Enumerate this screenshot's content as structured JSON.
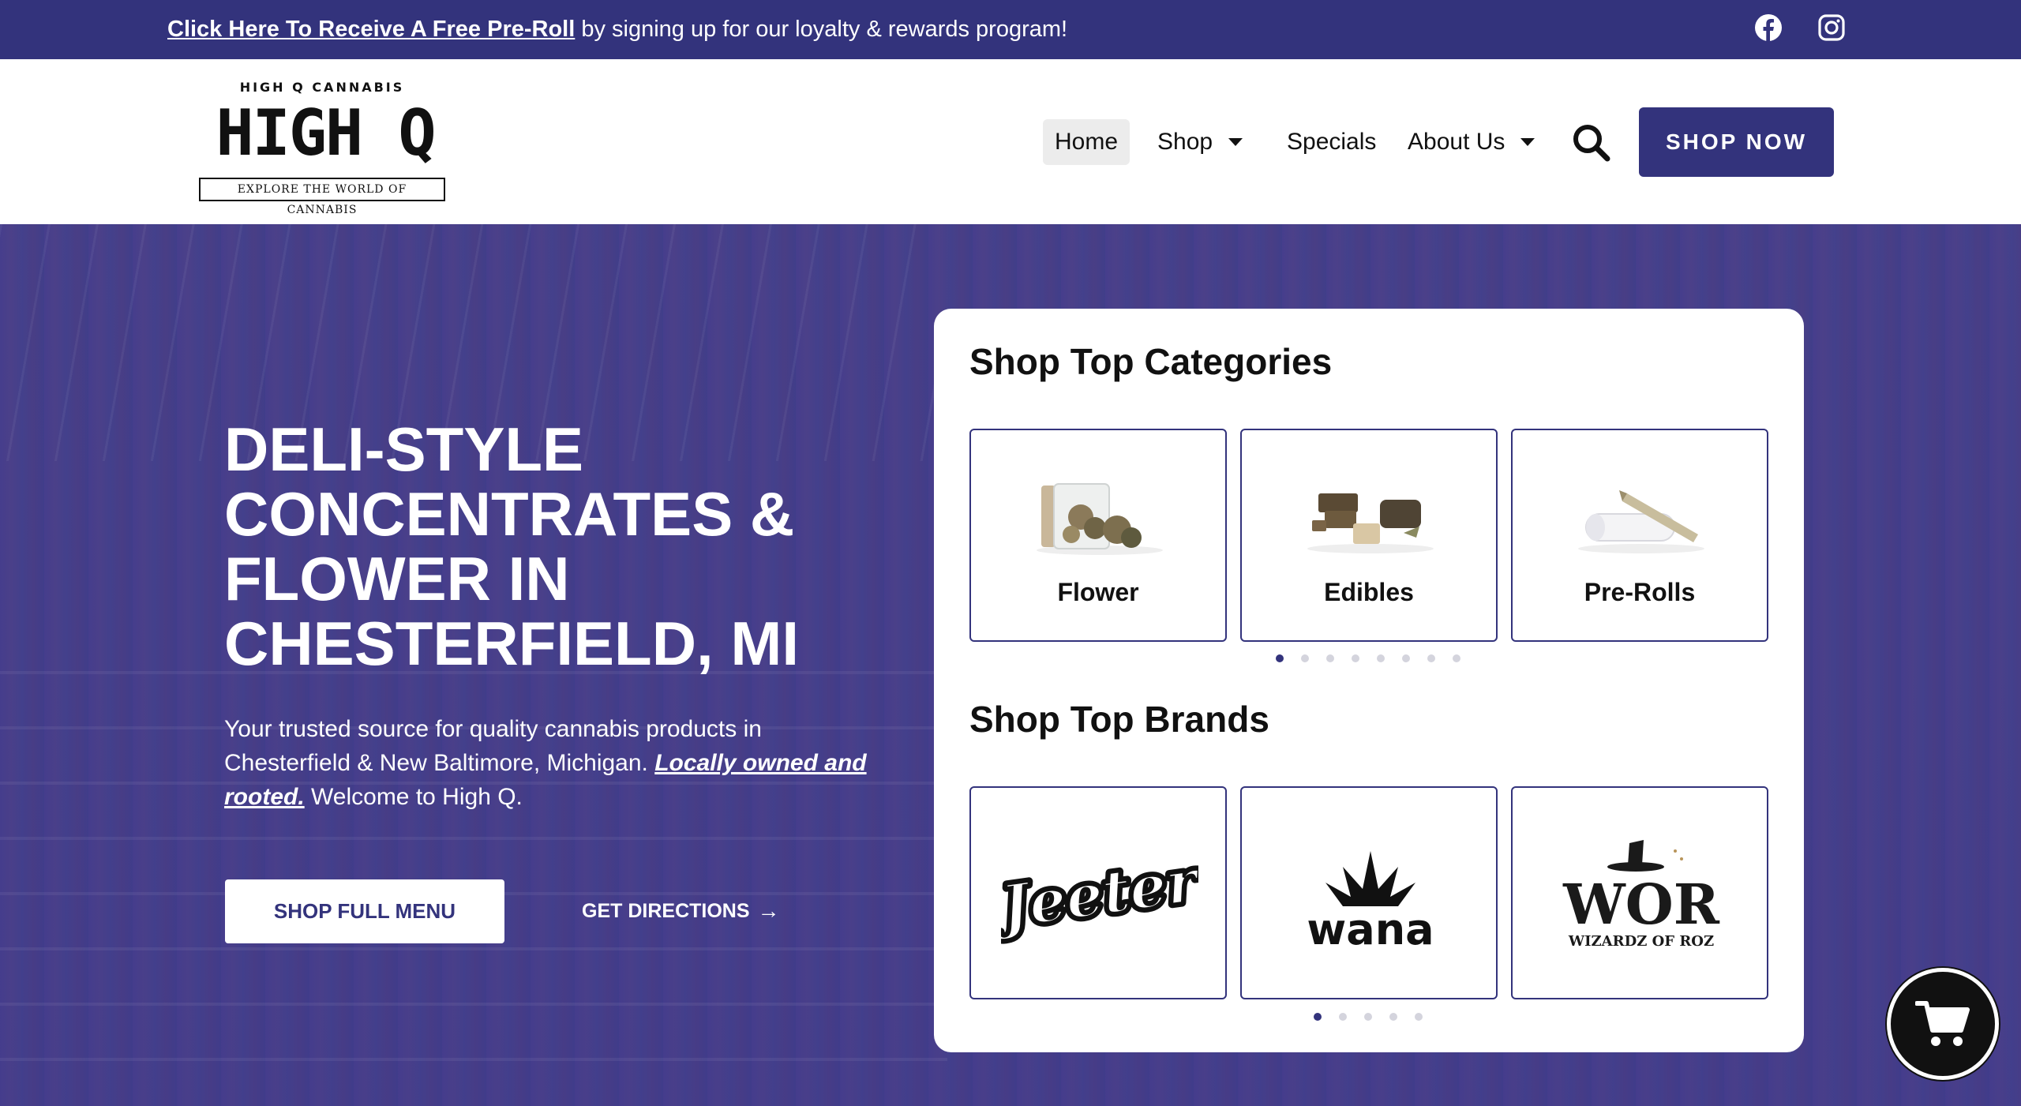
{
  "promo": {
    "link_text": "Click Here To Receive A Free Pre-Roll",
    "rest_text": " by signing up for our loyalty & rewards program!"
  },
  "social": {
    "facebook_icon": "facebook-icon",
    "instagram_icon": "instagram-icon"
  },
  "logo": {
    "top_text": "HIGH Q CANNABIS",
    "main_text": "HIGH Q",
    "tagline": "EXPLORE THE WORLD OF CANNABIS"
  },
  "nav": {
    "home": "Home",
    "shop": "Shop",
    "specials": "Specials",
    "about": "About Us",
    "search_icon": "search-icon",
    "shop_now": "SHOP NOW"
  },
  "hero": {
    "title": "DELI-STYLE CONCENTRATES & FLOWER IN CHESTERFIELD, MI",
    "desc_part1": "Your trusted source for quality cannabis products in Chesterfield & New Baltimore, Michigan. ",
    "desc_emphasis": "Locally owned and rooted.",
    "desc_part2": " Welcome to High Q.",
    "menu_button": "SHOP FULL MENU",
    "directions_button": "GET DIRECTIONS"
  },
  "categories": {
    "heading": "Shop Top Categories",
    "items": [
      {
        "label": "Flower"
      },
      {
        "label": "Edibles"
      },
      {
        "label": "Pre-Rolls"
      }
    ],
    "dot_count": 8,
    "active_dot": 1
  },
  "brands": {
    "heading": "Shop Top Brands",
    "items": [
      {
        "name": "Jeeter"
      },
      {
        "name": "wana"
      },
      {
        "name": "WOR",
        "subtitle": "WIZARDZ OF ROZ"
      }
    ],
    "dot_count": 5,
    "active_dot": 1
  },
  "cart": {
    "icon": "shopping-cart-icon"
  },
  "colors": {
    "brand": "#33337c",
    "hero_overlay": "#3e378c",
    "white": "#ffffff"
  }
}
